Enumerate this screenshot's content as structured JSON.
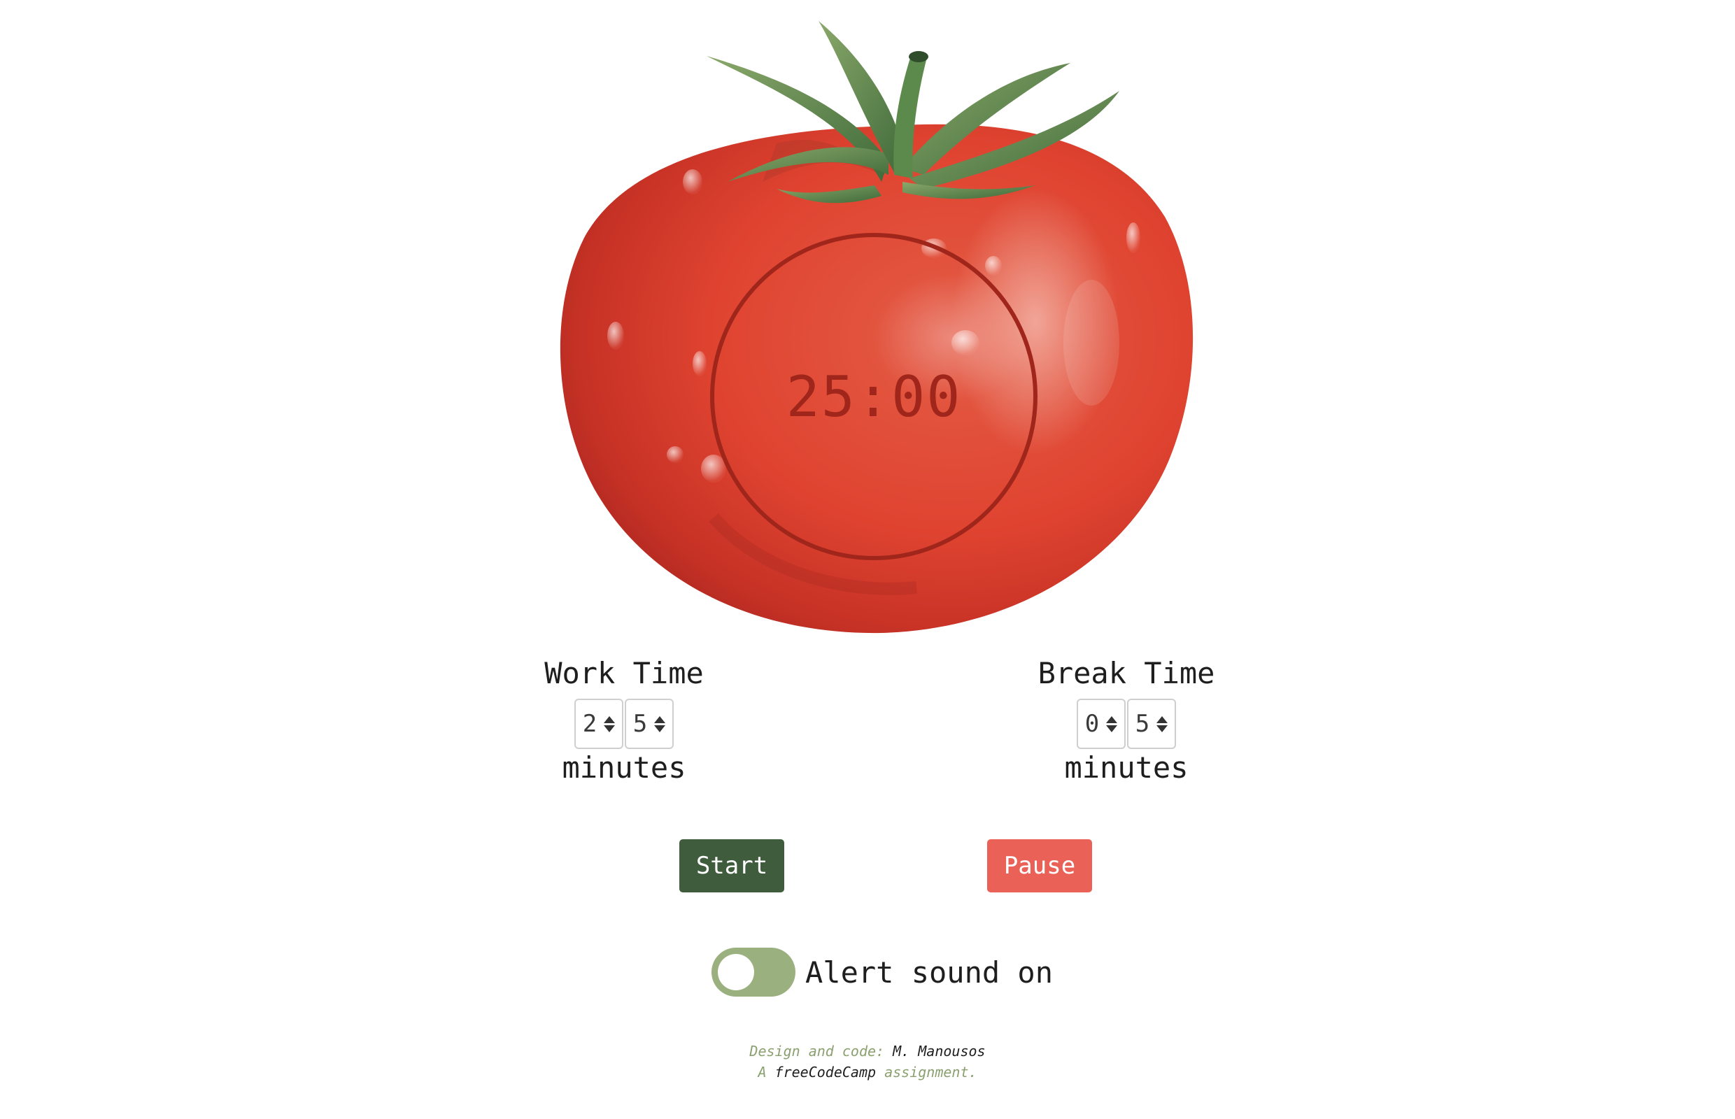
{
  "timer": {
    "display": "25:00"
  },
  "work": {
    "title": "Work Time",
    "digits": [
      "2",
      "5"
    ],
    "unit": "minutes"
  },
  "break": {
    "title": "Break Time",
    "digits": [
      "0",
      "5"
    ],
    "unit": "minutes"
  },
  "buttons": {
    "start_label": "Start",
    "pause_label": "Pause"
  },
  "alert": {
    "label": "Alert sound on",
    "state": "off"
  },
  "footer": {
    "line1_prefix": "Design and code:",
    "line1_author": "M. Manousos",
    "line2_prefix": "A",
    "line2_org": "freeCodeCamp",
    "line2_suffix": "assignment."
  },
  "colors": {
    "tomato": "#e2412c",
    "timer_ring": "#a0261b",
    "start_button": "#3f5c3c",
    "pause_button": "#ea6257",
    "toggle_track": "#9bb07f",
    "footer_muted": "#8aa06e"
  },
  "icons": {
    "tomato_image": "tomato-illustration",
    "spinner": "up-down-arrows-icon"
  }
}
